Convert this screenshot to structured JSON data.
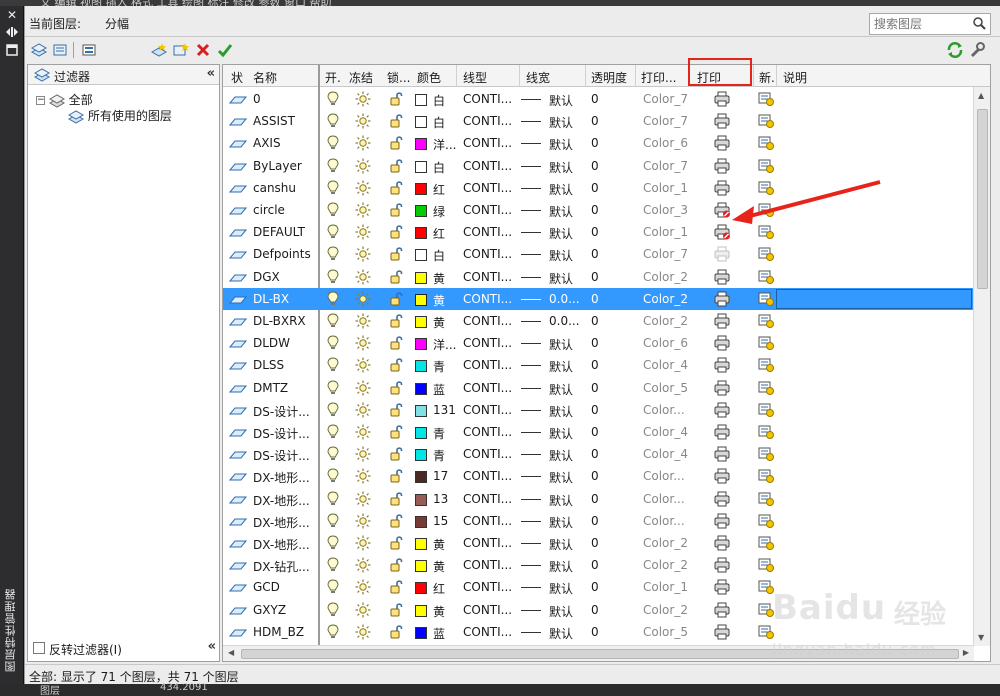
{
  "host": {
    "menu_text": "文 编辑 视图 插入 格式 工具 绘图 标注 修改 参数 窗口 帮助"
  },
  "palette": {
    "title": "图层特性管理器"
  },
  "current_layer": {
    "label": "当前图层:",
    "value": "分幅"
  },
  "search": {
    "placeholder": "搜索图层"
  },
  "filter_pane": {
    "header": "过滤器",
    "nodes": [
      {
        "label": "全部"
      },
      {
        "label": "所有使用的图层"
      }
    ],
    "invert_label": "反转过滤器(I)"
  },
  "columns": {
    "status": "状",
    "name": "名称",
    "on": "开.",
    "freeze": "冻结",
    "lock": "锁...",
    "color": "颜色",
    "linetype": "线型",
    "lineweight": "线宽",
    "transparency": "透明度",
    "plot_style": "打印...",
    "plot": "打印",
    "new_vp_freeze": "新.",
    "description": "说明"
  },
  "rows": [
    {
      "name": "0",
      "color_hex": "#ffffff",
      "color_label": "白",
      "linetype": "CONTI...",
      "lineweight": "默认",
      "transparency": "0",
      "plot_style": "Color_7",
      "plot": "on"
    },
    {
      "name": "ASSIST",
      "color_hex": "#ffffff",
      "color_label": "白",
      "linetype": "CONTI...",
      "lineweight": "默认",
      "transparency": "0",
      "plot_style": "Color_7",
      "plot": "on"
    },
    {
      "name": "AXIS",
      "color_hex": "#ff00ff",
      "color_label": "洋...",
      "linetype": "CONTI...",
      "lineweight": "默认",
      "transparency": "0",
      "plot_style": "Color_6",
      "plot": "on"
    },
    {
      "name": "ByLayer",
      "color_hex": "#ffffff",
      "color_label": "白",
      "linetype": "CONTI...",
      "lineweight": "默认",
      "transparency": "0",
      "plot_style": "Color_7",
      "plot": "on"
    },
    {
      "name": "canshu",
      "color_hex": "#ff0000",
      "color_label": "红",
      "linetype": "CONTI...",
      "lineweight": "默认",
      "transparency": "0",
      "plot_style": "Color_1",
      "plot": "on"
    },
    {
      "name": "circle",
      "color_hex": "#00cc00",
      "color_label": "绿",
      "linetype": "CONTI...",
      "lineweight": "默认",
      "transparency": "0",
      "plot_style": "Color_3",
      "plot": "off"
    },
    {
      "name": "DEFAULT",
      "color_hex": "#ff0000",
      "color_label": "红",
      "linetype": "CONTI...",
      "lineweight": "默认",
      "transparency": "0",
      "plot_style": "Color_1",
      "plot": "off"
    },
    {
      "name": "Defpoints",
      "color_hex": "#ffffff",
      "color_label": "白",
      "linetype": "CONTI...",
      "lineweight": "默认",
      "transparency": "0",
      "plot_style": "Color_7",
      "plot": "disabled"
    },
    {
      "name": "DGX",
      "color_hex": "#ffff00",
      "color_label": "黄",
      "linetype": "CONTI...",
      "lineweight": "默认",
      "transparency": "0",
      "plot_style": "Color_2",
      "plot": "on"
    },
    {
      "name": "DL-BX",
      "color_hex": "#ffff00",
      "color_label": "黄",
      "linetype": "CONTI...",
      "lineweight": "0.0...",
      "transparency": "0",
      "plot_style": "Color_2",
      "plot": "on",
      "selected": true
    },
    {
      "name": "DL-BXRX",
      "color_hex": "#ffff00",
      "color_label": "黄",
      "linetype": "CONTI...",
      "lineweight": "0.0...",
      "transparency": "0",
      "plot_style": "Color_2",
      "plot": "on"
    },
    {
      "name": "DLDW",
      "color_hex": "#ff00ff",
      "color_label": "洋...",
      "linetype": "CONTI...",
      "lineweight": "默认",
      "transparency": "0",
      "plot_style": "Color_6",
      "plot": "on"
    },
    {
      "name": "DLSS",
      "color_hex": "#00e5e5",
      "color_label": "青",
      "linetype": "CONTI...",
      "lineweight": "默认",
      "transparency": "0",
      "plot_style": "Color_4",
      "plot": "on"
    },
    {
      "name": "DMTZ",
      "color_hex": "#0000ff",
      "color_label": "蓝",
      "linetype": "CONTI...",
      "lineweight": "默认",
      "transparency": "0",
      "plot_style": "Color_5",
      "plot": "on"
    },
    {
      "name": "DS-设计...",
      "color_hex": "#7fe0e6",
      "color_label": "131",
      "linetype": "CONTI...",
      "lineweight": "默认",
      "transparency": "0",
      "plot_style": "Color...",
      "plot": "on"
    },
    {
      "name": "DS-设计...",
      "color_hex": "#00e5e5",
      "color_label": "青",
      "linetype": "CONTI...",
      "lineweight": "默认",
      "transparency": "0",
      "plot_style": "Color_4",
      "plot": "on"
    },
    {
      "name": "DS-设计...",
      "color_hex": "#00e5e5",
      "color_label": "青",
      "linetype": "CONTI...",
      "lineweight": "默认",
      "transparency": "0",
      "plot_style": "Color_4",
      "plot": "on"
    },
    {
      "name": "DX-地形...",
      "color_hex": "#4a2a22",
      "color_label": "17",
      "linetype": "CONTI...",
      "lineweight": "默认",
      "transparency": "0",
      "plot_style": "Color...",
      "plot": "on"
    },
    {
      "name": "DX-地形...",
      "color_hex": "#9a5a56",
      "color_label": "13",
      "linetype": "CONTI...",
      "lineweight": "默认",
      "transparency": "0",
      "plot_style": "Color...",
      "plot": "on"
    },
    {
      "name": "DX-地形...",
      "color_hex": "#7a3a34",
      "color_label": "15",
      "linetype": "CONTI...",
      "lineweight": "默认",
      "transparency": "0",
      "plot_style": "Color...",
      "plot": "on"
    },
    {
      "name": "DX-地形...",
      "color_hex": "#ffff00",
      "color_label": "黄",
      "linetype": "CONTI...",
      "lineweight": "默认",
      "transparency": "0",
      "plot_style": "Color_2",
      "plot": "on"
    },
    {
      "name": "DX-钻孔...",
      "color_hex": "#ffff00",
      "color_label": "黄",
      "linetype": "CONTI...",
      "lineweight": "默认",
      "transparency": "0",
      "plot_style": "Color_2",
      "plot": "on"
    },
    {
      "name": "GCD",
      "color_hex": "#ff0000",
      "color_label": "红",
      "linetype": "CONTI...",
      "lineweight": "默认",
      "transparency": "0",
      "plot_style": "Color_1",
      "plot": "on"
    },
    {
      "name": "GXYZ",
      "color_hex": "#ffff00",
      "color_label": "黄",
      "linetype": "CONTI...",
      "lineweight": "默认",
      "transparency": "0",
      "plot_style": "Color_2",
      "plot": "on"
    },
    {
      "name": "HDM_BZ",
      "color_hex": "#0000ff",
      "color_label": "蓝",
      "linetype": "CONTI...",
      "lineweight": "默认",
      "transparency": "0",
      "plot_style": "Color_5",
      "plot": "on"
    }
  ],
  "status_bar": {
    "text": "全部: 显示了 71 个图层，共 71 个图层"
  },
  "bottom_strip": {
    "left": "图层",
    "right": "434.2091"
  },
  "watermark": {
    "brand": "Baidu",
    "sub": "经验",
    "url": "jingyan.baidu.com"
  },
  "colors": {
    "selection": "#3399ff",
    "annotation": "#e8231a"
  }
}
